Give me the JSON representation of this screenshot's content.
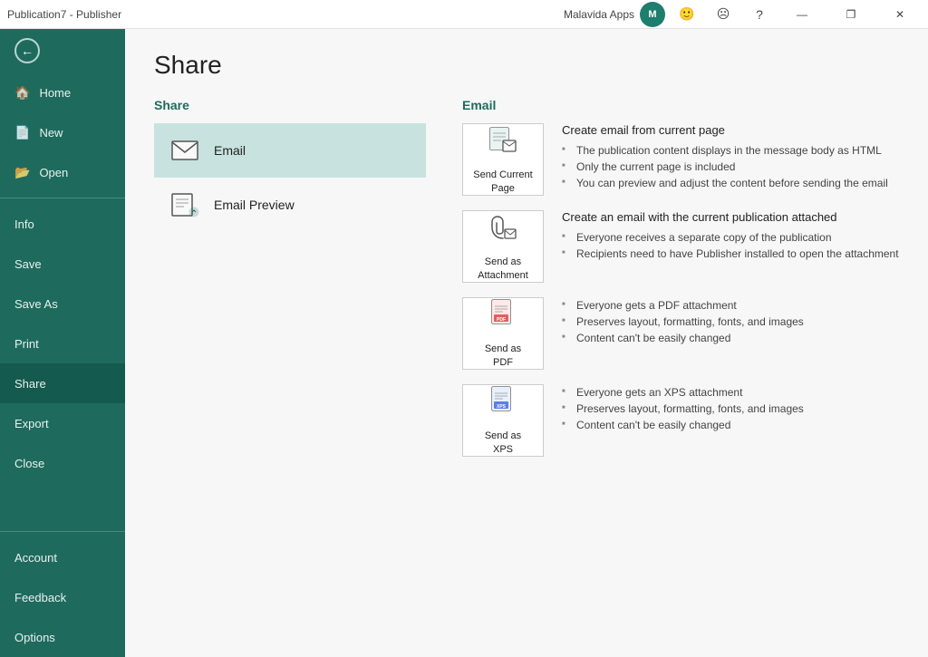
{
  "titlebar": {
    "title": "Publication7 - Publisher",
    "app_name": "Malavida Apps",
    "minimize_label": "—",
    "restore_label": "❐",
    "close_label": "✕",
    "help_label": "?"
  },
  "sidebar": {
    "back_icon": "←",
    "home_label": "Home",
    "new_label": "New",
    "open_label": "Open",
    "info_label": "Info",
    "save_label": "Save",
    "save_as_label": "Save As",
    "print_label": "Print",
    "share_label": "Share",
    "export_label": "Export",
    "close_label": "Close",
    "account_label": "Account",
    "feedback_label": "Feedback",
    "options_label": "Options"
  },
  "page": {
    "title": "Share"
  },
  "share_section": {
    "title": "Share",
    "options": [
      {
        "id": "email",
        "label": "Email",
        "active": true
      },
      {
        "id": "email-preview",
        "label": "Email Preview",
        "active": false
      }
    ]
  },
  "email_section": {
    "title": "Email",
    "options": [
      {
        "id": "send-current-page",
        "card_label": "Send Current\nPage",
        "desc_title": "Create email from current page",
        "bullets": [
          "The publication content displays in the message body as HTML",
          "Only the current page is included",
          "You can preview and adjust the content before sending the email"
        ]
      },
      {
        "id": "send-as-attachment",
        "card_label": "Send as\nAttachment",
        "desc_title": "Create an email with the current publication attached",
        "bullets": [
          "Everyone receives a separate copy of the publication",
          "Recipients need to have Publisher installed to open the attachment"
        ]
      },
      {
        "id": "send-as-pdf",
        "card_label": "Send as\nPDF",
        "desc_title": "",
        "bullets": [
          "Everyone gets a PDF attachment",
          "Preserves layout, formatting, fonts, and images",
          "Content can't be easily changed"
        ]
      },
      {
        "id": "send-as-xps",
        "card_label": "Send as\nXPS",
        "desc_title": "",
        "bullets": [
          "Everyone gets an XPS attachment",
          "Preserves layout, formatting, fonts, and images",
          "Content can't be easily changed"
        ]
      }
    ]
  }
}
